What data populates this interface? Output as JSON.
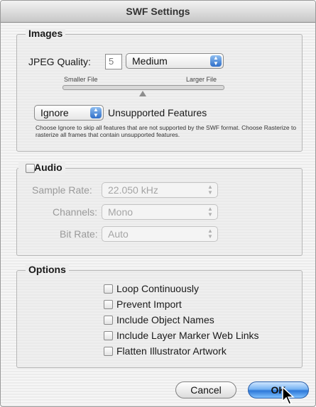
{
  "window": {
    "title": "SWF Settings"
  },
  "images": {
    "legend": "Images",
    "jpeg_quality_label": "JPEG Quality:",
    "jpeg_quality_value": "5",
    "quality_preset": "Medium",
    "slider_min_label": "Smaller File",
    "slider_max_label": "Larger File",
    "slider_level": 0.5,
    "unsupported_mode": "Ignore",
    "unsupported_label": "Unsupported Features",
    "help_text": "Choose Ignore to skip all features that are not supported by the SWF format. Choose Rasterize to rasterize all frames that contain unsupported features."
  },
  "audio": {
    "legend": "Audio",
    "sample_rate_label": "Sample Rate:",
    "sample_rate_value": "22.050 kHz",
    "channels_label": "Channels:",
    "channels_value": "Mono",
    "bit_rate_label": "Bit Rate:",
    "bit_rate_value": "Auto"
  },
  "options": {
    "legend": "Options",
    "items": [
      {
        "label": "Loop Continuously"
      },
      {
        "label": "Prevent Import"
      },
      {
        "label": "Include Object Names"
      },
      {
        "label": "Include Layer Marker Web Links"
      },
      {
        "label": "Flatten Illustrator Artwork"
      }
    ]
  },
  "buttons": {
    "cancel": "Cancel",
    "ok": "OK"
  },
  "colors": {
    "accent": "#2f6fc9",
    "default_button": "#4a90e2"
  },
  "icons": {
    "popup_arrows": "updown-arrows-icon",
    "cursor": "arrow-cursor-icon"
  }
}
